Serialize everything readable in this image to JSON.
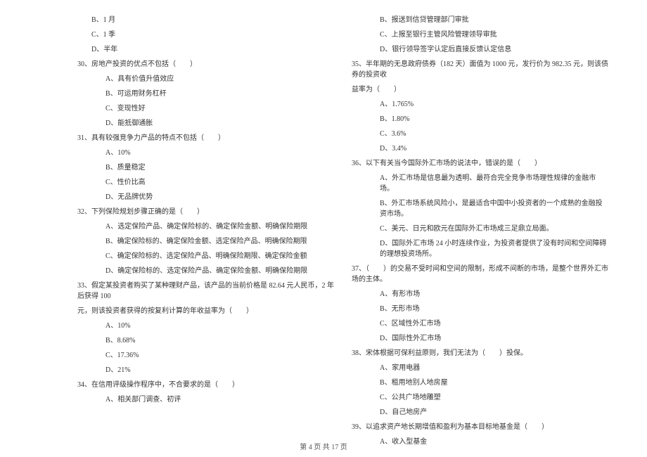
{
  "left": {
    "opts_pre": [
      "B、1 月",
      "C、1 季",
      "D、半年"
    ],
    "q30": "30、房地产投资的优点不包括（　　）",
    "q30_opts": [
      "A、具有价值升值效应",
      "B、可运用财务杠杆",
      "C、变现性好",
      "D、能抵御通胀"
    ],
    "q31": "31、具有较强竞争力产品的特点不包括（　　）",
    "q31_opts": [
      "A、10%",
      "B、质量稳定",
      "C、性价比高",
      "D、无品牌优势"
    ],
    "q32": "32、下列保险规划步骤正确的是（　　）",
    "q32_opts": [
      "A、选定保险产品、确定保险标的、确定保险金额、明确保险期限",
      "B、确定保险标的、确定保险金额、选定保险产品、明确保险期限",
      "C、确定保险标的、选定保险产品、明确保险期限、确定保险金额",
      "D、确定保险标的、选定保险产品、确定保险金额、明确保险期限"
    ],
    "q33": "33、假定某投资者购买了某种理财产品，该产品的当前价格是 82.64 元人民币，2 年后获得 100",
    "q33_cont": "元，则该投资者获得的按复利计算的年收益率为（　　）",
    "q33_opts": [
      "A、10%",
      "B、8.68%",
      "C、17.36%",
      "D、21%"
    ],
    "q34": "34、在信用评级操作程序中，不合要求的是（　　）",
    "q34_opts": [
      "A、相关部门调查、初评"
    ]
  },
  "right": {
    "opts_pre": [
      "B、报送到信贷管理部门审批",
      "C、上报至银行主管风险管理领导审批",
      "D、银行领导签字认定后直接反馈认定信息"
    ],
    "q35": "35、半年期的无息政府债券（182 天）面值为 1000 元，发行价为 982.35 元，则该债券的投资收",
    "q35_cont": "益率为（　　）",
    "q35_opts": [
      "A、1.765%",
      "B、1.80%",
      "C、3.6%",
      "D、3.4%"
    ],
    "q36": "36、以下有关当今国际外汇市场的说法中，错误的是（　　）",
    "q36_opts": [
      "A、外汇市场是信息最为透明、最符合完全竞争市场理性规律的金融市场。",
      "B、外汇市场系统风险小，是最适合中国中小投资者的一个成熟的金融投资市场。",
      "C、美元、日元和欧元在国际外汇市场成三足鼎立局面。",
      "D、国际外汇市场 24 小时连续作业，为投资者提供了没有时间和空间障碍的理想投资场所。"
    ],
    "q37": "37、（　　）的交易不受时间和空间的限制，形成不间断的市场，是整个世界外汇市场的主体。",
    "q37_opts": [
      "A、有形市场",
      "B、无形市场",
      "C、区域性外汇市场",
      "D、国际性外汇市场"
    ],
    "q38": "38、宋体根据可保利益原则，我们无法为（　　）投保。",
    "q38_opts": [
      "A、家用电器",
      "B、租用地别人地房屋",
      "C、公共广场地雕塑",
      "D、自己地房产"
    ],
    "q39": "39、以追求资产地长期增值和盈利为基本目标地基金是（　　）",
    "q39_opts": [
      "A、收入型基金"
    ]
  },
  "footer": "第 4 页 共 17 页"
}
